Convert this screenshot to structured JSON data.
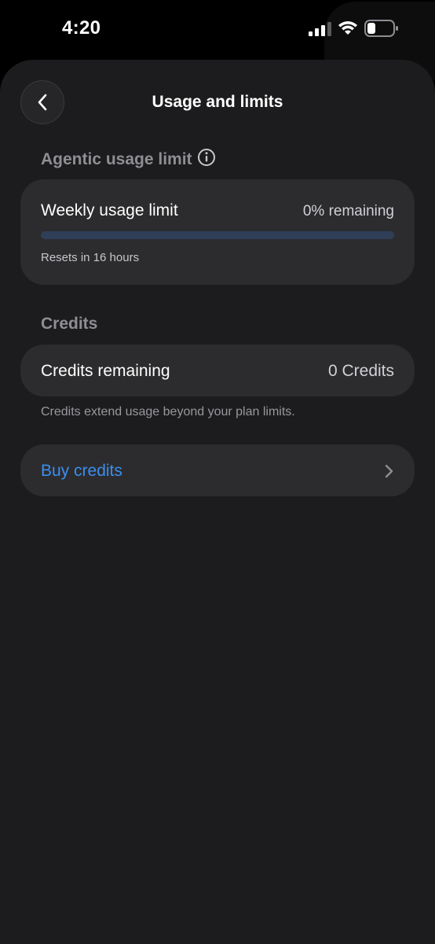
{
  "status_bar": {
    "time": "4:20",
    "icons": [
      "cellular-signal-icon",
      "wifi-icon",
      "battery-icon"
    ]
  },
  "header": {
    "title": "Usage and limits",
    "back_icon": "chevron-left-icon"
  },
  "agentic_section": {
    "title": "Agentic usage limit",
    "info_icon": "info-icon",
    "weekly": {
      "label": "Weekly usage limit",
      "value": "0% remaining",
      "remaining_fraction": 0,
      "reset_text": "Resets in 16 hours"
    }
  },
  "credits_section": {
    "title": "Credits",
    "row": {
      "label": "Credits remaining",
      "value": "0 Credits"
    },
    "footnote": "Credits extend usage beyond your plan limits."
  },
  "buy": {
    "label": "Buy credits",
    "chevron_icon": "chevron-right-icon"
  },
  "colors": {
    "background": "#1c1c1e",
    "card": "#2c2c2e",
    "accent": "#3a8ef0",
    "progress_track": "#2f3f58"
  }
}
